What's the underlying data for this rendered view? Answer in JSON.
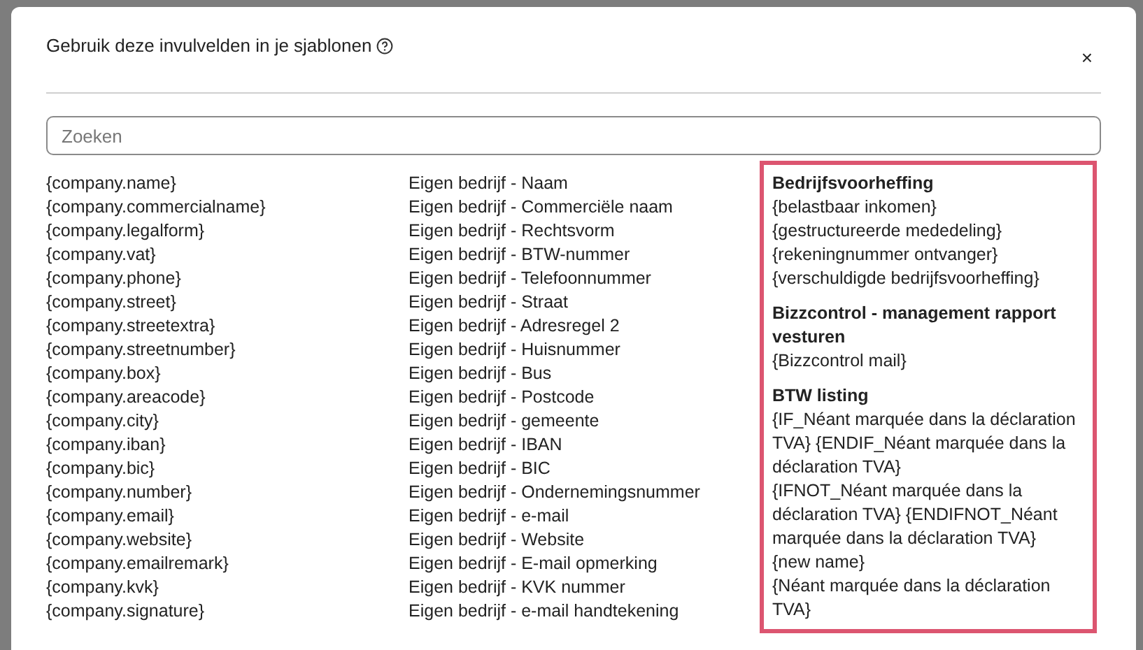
{
  "dialog": {
    "title": "Gebruik deze invulvelden in je sjablonen",
    "close": "×"
  },
  "search": {
    "placeholder": "Zoeken"
  },
  "fields": [
    {
      "code": "{company.name}",
      "description": "Eigen bedrijf - Naam"
    },
    {
      "code": "{company.commercialname}",
      "description": "Eigen bedrijf - Commerciële naam"
    },
    {
      "code": "{company.legalform}",
      "description": "Eigen bedrijf - Rechtsvorm"
    },
    {
      "code": "{company.vat}",
      "description": "Eigen bedrijf - BTW-nummer"
    },
    {
      "code": "{company.phone}",
      "description": "Eigen bedrijf - Telefoonnummer"
    },
    {
      "code": "{company.street}",
      "description": "Eigen bedrijf - Straat"
    },
    {
      "code": "{company.streetextra}",
      "description": "Eigen bedrijf - Adresregel 2"
    },
    {
      "code": "{company.streetnumber}",
      "description": "Eigen bedrijf - Huisnummer"
    },
    {
      "code": "{company.box}",
      "description": "Eigen bedrijf - Bus"
    },
    {
      "code": "{company.areacode}",
      "description": "Eigen bedrijf - Postcode"
    },
    {
      "code": "{company.city}",
      "description": "Eigen bedrijf - gemeente"
    },
    {
      "code": "{company.iban}",
      "description": "Eigen bedrijf - IBAN"
    },
    {
      "code": "{company.bic}",
      "description": "Eigen bedrijf - BIC"
    },
    {
      "code": "{company.number}",
      "description": "Eigen bedrijf - Ondernemingsnummer"
    },
    {
      "code": "{company.email}",
      "description": "Eigen bedrijf - e-mail"
    },
    {
      "code": "{company.website}",
      "description": "Eigen bedrijf - Website"
    },
    {
      "code": "{company.emailremark}",
      "description": "Eigen bedrijf - E-mail opmerking"
    },
    {
      "code": "{company.kvk}",
      "description": "Eigen bedrijf - KVK nummer"
    },
    {
      "code": "{company.signature}",
      "description": "Eigen bedrijf - e-mail handtekening"
    }
  ],
  "groups": [
    {
      "title": "Bedrijfsvoorheffing",
      "items": [
        "{belastbaar inkomen}",
        "{gestructureerde mededeling}",
        "{rekeningnummer ontvanger}",
        "{verschuldigde bedrijfsvoorheffing}"
      ]
    },
    {
      "title": "Bizzcontrol - management rapport vesturen",
      "items": [
        "{Bizzcontrol mail}"
      ]
    },
    {
      "title": "BTW listing",
      "items": [
        "{IF_Néant marquée dans la déclaration TVA} {ENDIF_Néant marquée dans la déclaration TVA}",
        "{IFNOT_Néant marquée dans la déclaration TVA} {ENDIFNOT_Néant marquée dans la déclaration TVA}",
        "{new name}",
        "{Néant marquée dans la déclaration TVA}"
      ]
    }
  ]
}
